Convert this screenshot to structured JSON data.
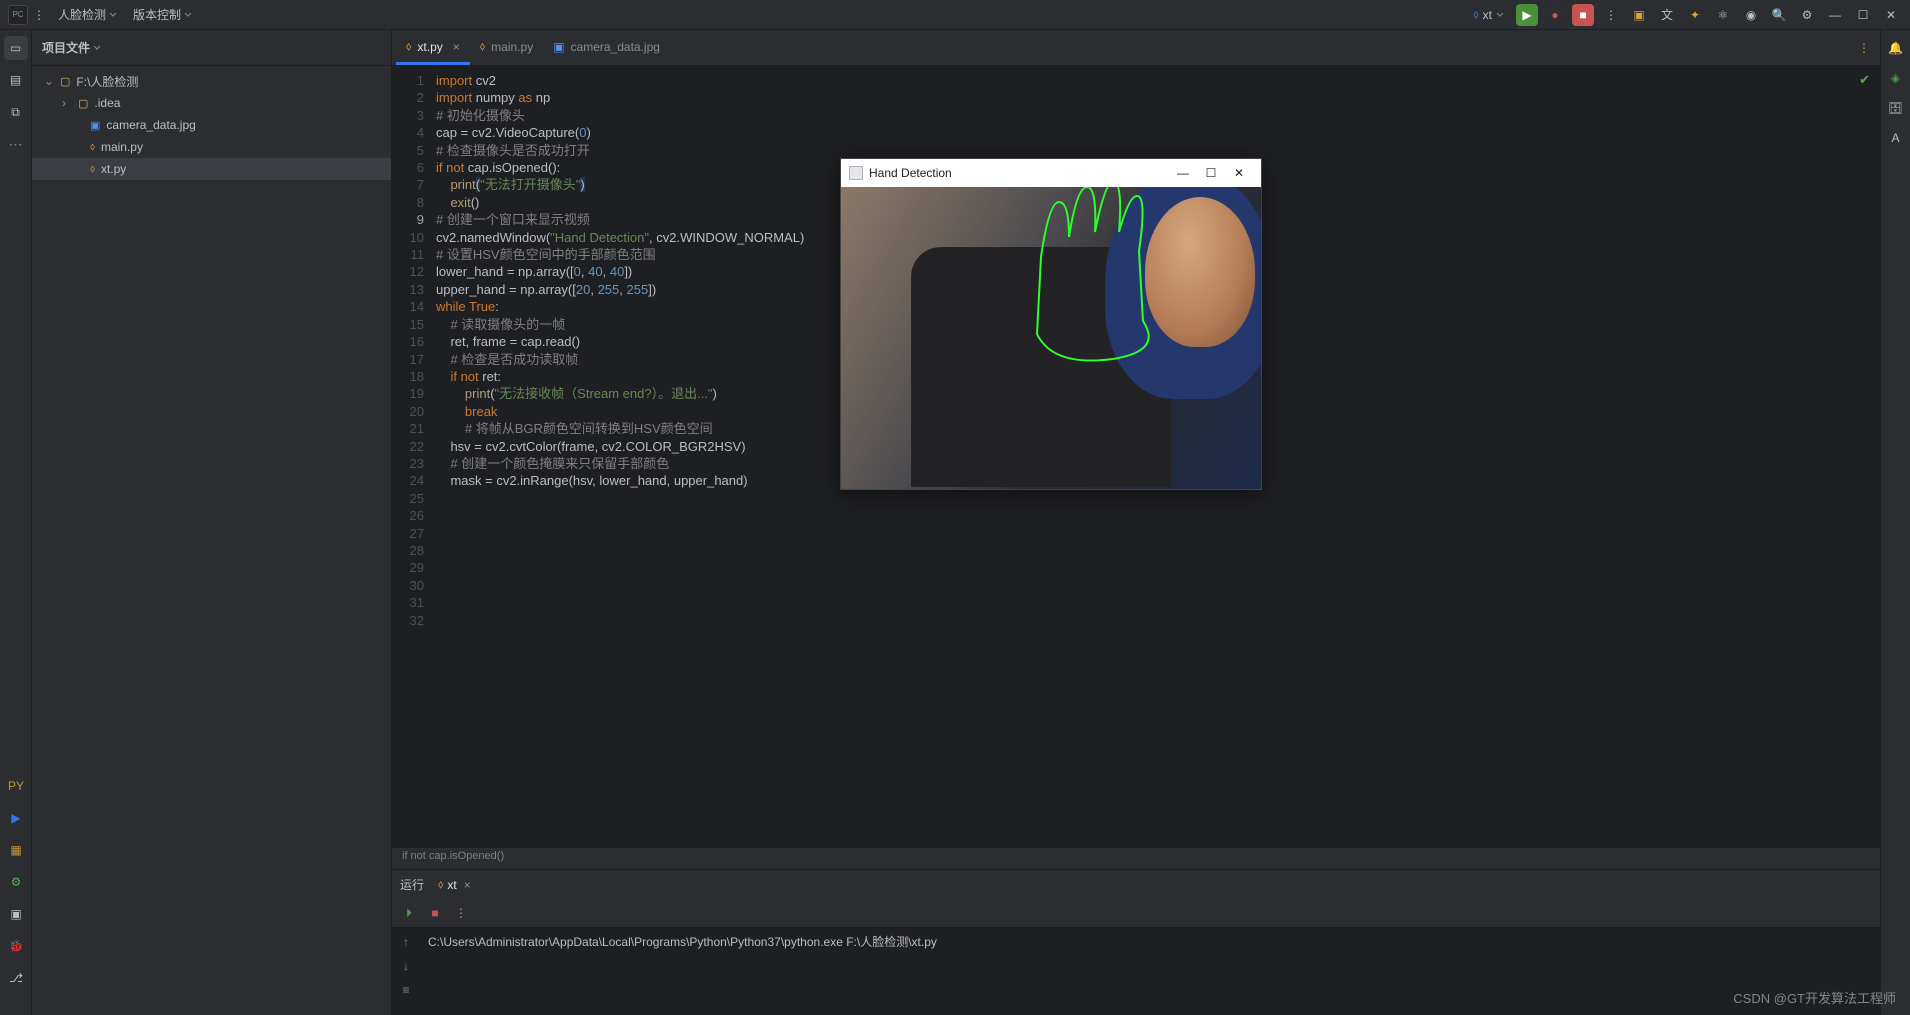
{
  "menubar": {
    "project": "人脸检测",
    "vcs": "版本控制",
    "runconfig": "xt"
  },
  "project_panel": {
    "title": "项目文件",
    "root": "F:\\人脸检测",
    "nodes": [
      {
        "name": ".idea",
        "type": "folder"
      },
      {
        "name": "camera_data.jpg",
        "type": "image"
      },
      {
        "name": "main.py",
        "type": "python"
      },
      {
        "name": "xt.py",
        "type": "python",
        "selected": true
      }
    ]
  },
  "tabs": [
    {
      "name": "xt.py",
      "tico": "py",
      "active": true,
      "close": true
    },
    {
      "name": "main.py",
      "tico": "py",
      "active": false,
      "close": false
    },
    {
      "name": "camera_data.jpg",
      "tico": "img",
      "active": false,
      "close": false
    }
  ],
  "code": {
    "start_line": 1,
    "current_line": 9,
    "lines": [
      {
        "t": [
          [
            "kw",
            "import"
          ],
          [
            "plain",
            " cv2"
          ]
        ]
      },
      {
        "t": [
          [
            "kw",
            "import"
          ],
          [
            "plain",
            " numpy "
          ],
          [
            "kw",
            "as"
          ],
          [
            "plain",
            " np"
          ]
        ]
      },
      {
        "t": [
          [
            "plain",
            ""
          ]
        ]
      },
      {
        "t": [
          [
            "cmt",
            "# 初始化摄像头"
          ]
        ]
      },
      {
        "t": [
          [
            "plain",
            "cap = cv2.VideoCapture("
          ],
          [
            "num",
            "0"
          ],
          [
            "plain",
            ")"
          ]
        ]
      },
      {
        "t": [
          [
            "plain",
            ""
          ]
        ]
      },
      {
        "t": [
          [
            "cmt",
            "# 检查摄像头是否成功打开"
          ]
        ]
      },
      {
        "t": [
          [
            "kw",
            "if not"
          ],
          [
            "plain",
            " cap.isOpened():"
          ]
        ]
      },
      {
        "t": [
          [
            "plain",
            "    "
          ],
          [
            "fn",
            "print"
          ],
          [
            "hl",
            "("
          ],
          [
            "str",
            "\"无法打开摄像头\""
          ],
          [
            "hl",
            ")"
          ]
        ]
      },
      {
        "t": [
          [
            "plain",
            "    "
          ],
          [
            "fn",
            "exit"
          ],
          [
            "plain",
            "()"
          ]
        ]
      },
      {
        "t": [
          [
            "plain",
            ""
          ]
        ]
      },
      {
        "t": [
          [
            "cmt",
            "# 创建一个窗口来显示视频"
          ]
        ]
      },
      {
        "t": [
          [
            "plain",
            "cv2.namedWindow("
          ],
          [
            "str",
            "\"Hand Detection\""
          ],
          [
            "plain",
            ", cv2.WINDOW_NORMAL)"
          ]
        ]
      },
      {
        "t": [
          [
            "plain",
            ""
          ]
        ]
      },
      {
        "t": [
          [
            "cmt",
            "# 设置HSV颜色空间中的手部颜色范围"
          ]
        ]
      },
      {
        "t": [
          [
            "plain",
            "lower_hand = np.array(["
          ],
          [
            "num",
            "0"
          ],
          [
            "plain",
            ", "
          ],
          [
            "num",
            "40"
          ],
          [
            "plain",
            ", "
          ],
          [
            "num",
            "40"
          ],
          [
            "plain",
            "])"
          ]
        ]
      },
      {
        "t": [
          [
            "plain",
            "upper_hand = np.array(["
          ],
          [
            "num",
            "20"
          ],
          [
            "plain",
            ", "
          ],
          [
            "num",
            "255"
          ],
          [
            "plain",
            ", "
          ],
          [
            "num",
            "255"
          ],
          [
            "plain",
            "])"
          ]
        ]
      },
      {
        "t": [
          [
            "plain",
            ""
          ]
        ]
      },
      {
        "t": [
          [
            "kw",
            "while True"
          ],
          [
            "plain",
            ":"
          ]
        ]
      },
      {
        "t": [
          [
            "plain",
            "    "
          ],
          [
            "cmt",
            "# 读取摄像头的一帧"
          ]
        ]
      },
      {
        "t": [
          [
            "plain",
            "    ret, frame = cap.read()"
          ]
        ]
      },
      {
        "t": [
          [
            "plain",
            ""
          ]
        ]
      },
      {
        "t": [
          [
            "plain",
            "    "
          ],
          [
            "cmt",
            "# 检查是否成功读取帧"
          ]
        ]
      },
      {
        "t": [
          [
            "plain",
            "    "
          ],
          [
            "kw",
            "if not"
          ],
          [
            "plain",
            " ret:"
          ]
        ]
      },
      {
        "t": [
          [
            "plain",
            "        "
          ],
          [
            "fn",
            "print"
          ],
          [
            "plain",
            "("
          ],
          [
            "str",
            "\"无法接收帧（Stream end?）。退出...\""
          ],
          [
            "plain",
            ")"
          ]
        ]
      },
      {
        "t": [
          [
            "plain",
            "        "
          ],
          [
            "kw",
            "break"
          ]
        ]
      },
      {
        "t": [
          [
            "plain",
            ""
          ]
        ]
      },
      {
        "t": [
          [
            "plain",
            "        "
          ],
          [
            "cmt",
            "# 将帧从BGR颜色空间转换到HSV颜色空间"
          ]
        ]
      },
      {
        "t": [
          [
            "plain",
            "    hsv = cv2.cvtColor(frame, cv2.COLOR_BGR2HSV)"
          ]
        ]
      },
      {
        "t": [
          [
            "plain",
            ""
          ]
        ]
      },
      {
        "t": [
          [
            "plain",
            "    "
          ],
          [
            "cmt",
            "# 创建一个颜色掩膜来只保留手部颜色"
          ]
        ]
      },
      {
        "t": [
          [
            "plain",
            "    mask = cv2.inRange(hsv, lower_hand, upper_hand)"
          ]
        ]
      }
    ]
  },
  "breadcrumb": "if not cap.isOpened()",
  "run_panel": {
    "label": "运行",
    "tab": "xt",
    "output": "C:\\Users\\Administrator\\AppData\\Local\\Programs\\Python\\Python37\\python.exe F:\\人脸检测\\xt.py"
  },
  "popup": {
    "title": "Hand Detection"
  },
  "watermark": "CSDN @GT开发算法工程师"
}
